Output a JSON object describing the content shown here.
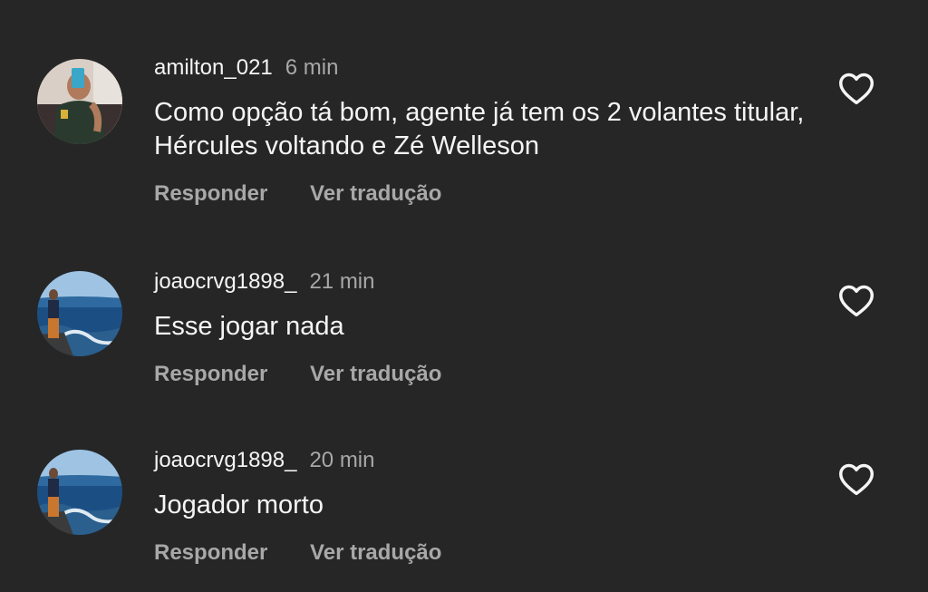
{
  "comments": [
    {
      "username": "amilton_021",
      "time": "6 min",
      "text": "Como opção tá bom, agente já tem os 2 volantes titular, Hércules voltando e Zé Welleson",
      "reply_label": "Responder",
      "translate_label": "Ver tradução",
      "like_icon": "heart-outline-icon"
    },
    {
      "username": "joaocrvg1898_",
      "time": "21 min",
      "text": "Esse jogar nada",
      "reply_label": "Responder",
      "translate_label": "Ver tradução",
      "like_icon": "heart-outline-icon"
    },
    {
      "username": "joaocrvg1898_",
      "time": "20 min",
      "text": "Jogador morto",
      "reply_label": "Responder",
      "translate_label": "Ver tradução",
      "like_icon": "heart-outline-icon"
    }
  ],
  "colors": {
    "background": "#262626",
    "primary_text": "#f5f5f5",
    "secondary_text": "#a8a8a8"
  }
}
